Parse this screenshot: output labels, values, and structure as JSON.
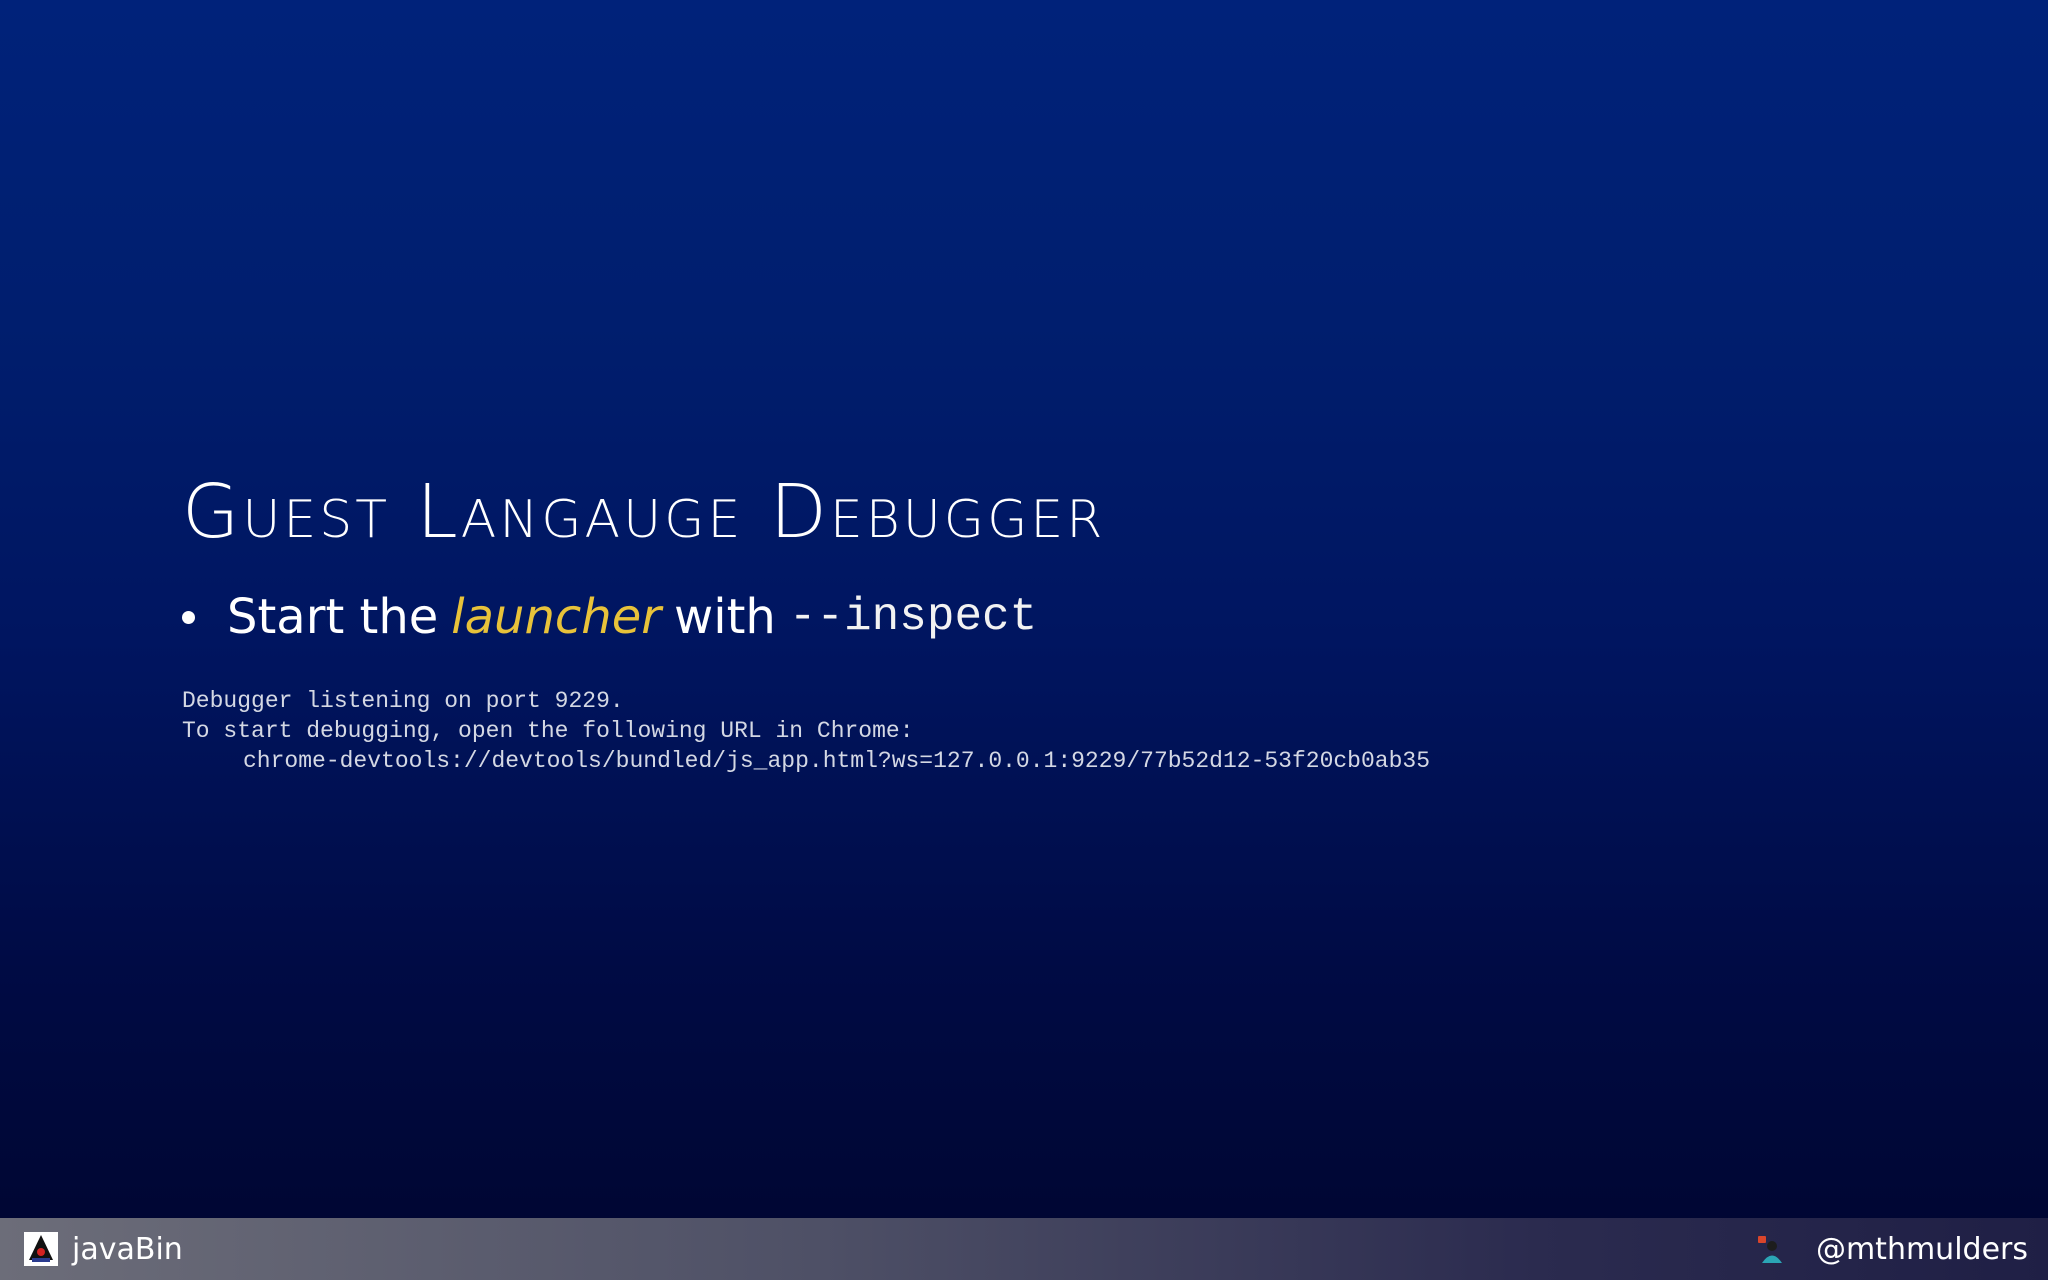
{
  "slide": {
    "title": "Guest Langauge Debugger",
    "bullet": {
      "prefix": "Start the",
      "emphasis": "launcher",
      "middle": "with",
      "code": "--inspect"
    },
    "console_lines": [
      "Debugger listening on port 9229.",
      "To start debugging, open the following URL in Chrome:",
      "chrome-devtools://devtools/bundled/js_app.html?ws=127.0.0.1:9229/77b52d12-53f20cb0ab35"
    ]
  },
  "footer": {
    "left_label": "javaBin",
    "right_label": "@mthmulders",
    "left_icon": "javabin-duke-logo-icon",
    "right_icon": "person-avatar-icon"
  },
  "colors": {
    "background_top": "#00227a",
    "background_bottom": "#00052f",
    "emphasis": "#e8c23a",
    "console_text": "#d4d8e4",
    "footer_left": "#6c6d79",
    "footer_right": "#1f1f45"
  }
}
